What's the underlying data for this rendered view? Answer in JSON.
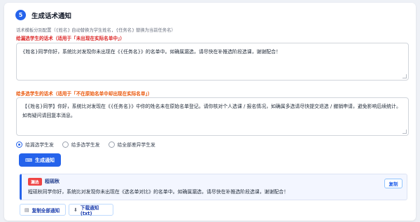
{
  "step": {
    "number": "5",
    "title": "生成话术通知"
  },
  "hint": "话术模板分别配置（{姓名} 自动替换为学生姓名，{任务名} 替换为当前任务名）",
  "missed": {
    "label": "给漏选学生的话术（适用于「未出现在实际名单中」）",
    "text": "{姓名}同学你好，系统比对发现你未出现在《{任务名}》的名单中。如确属漏选，请尽快在补推选阶段选课，谢谢配合！"
  },
  "extra": {
    "label": "给多选学生的话术（适用于「不在原始名单中却出现在实际名单」）",
    "text": "【{姓名}同学】你好，系统比对发现在《{任务名}》中你的姓名未在原始名单登记。请你核对个人选课 / 报名情况，如确属多选请尽快提交退选 / 撤销申请，避免影响后续统计。如有疑问请回复本消息。"
  },
  "radios": [
    {
      "label": "给漏选学生发",
      "checked": true
    },
    {
      "label": "给多选学生发",
      "checked": false
    },
    {
      "label": "给全部差异学生发",
      "checked": false
    }
  ],
  "generate_button": {
    "icon": "keyboard-icon",
    "label": "生成通知"
  },
  "result": {
    "badge": "漏选",
    "name": "程砚秋",
    "text": "程砚秋同学你好，系统比对发现你未出现在《选名单对比》的名单中。如确属漏选，请尽快在补推选阶段选课，谢谢配合！",
    "copy_label": "复制"
  },
  "actions": {
    "copy_all": {
      "icon": "clipboard-icon",
      "label": "复制全部通知"
    },
    "download": {
      "icon": "download-icon",
      "label": "下载通知(txt)"
    }
  },
  "colors": {
    "accent": "#2563eb",
    "missed": "#dc2626",
    "extra": "#ea580c",
    "badge": "#ef4444"
  }
}
